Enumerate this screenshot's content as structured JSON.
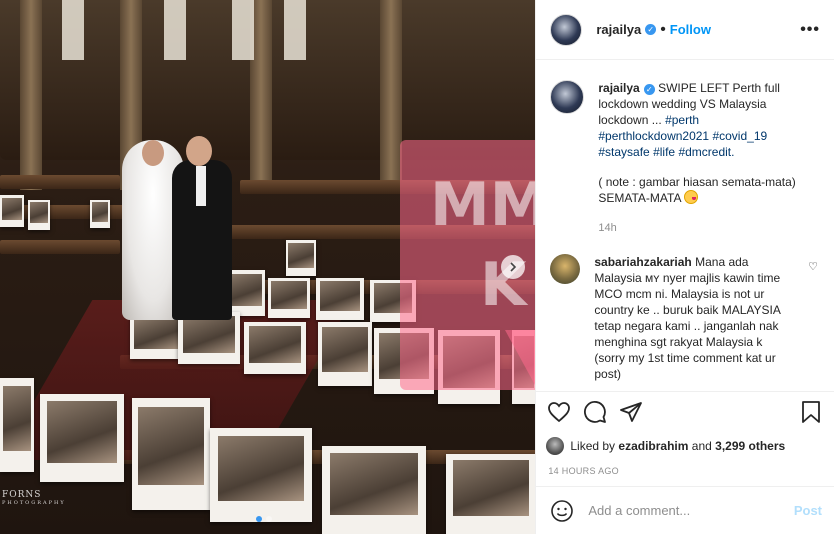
{
  "header": {
    "username": "rajailya",
    "separator": "•",
    "follow_label": "Follow",
    "more_label": "•••"
  },
  "caption": {
    "username": "rajailya",
    "text_prefix": "SWIPE LEFT Perth full lockdown wedding VS Malaysia lockdown ...",
    "hashtags": [
      "#perth",
      "#perthlockdown2021",
      "#covid_19",
      "#staysafe",
      "#life",
      "#dmcredit."
    ],
    "note": "( note : gambar hiasan semata-mata) SEMATA-MATA",
    "time": "14h"
  },
  "comment": {
    "username": "sabariahzakariah",
    "text": "Mana ada Malaysia ᴍʏ nyer majlis kawin time MCO mcm ni. Malaysia is not ur country ke .. buruk baik MALAYSIA tetap negara kami .. janganlah nak menghina sgt rakyat Malaysia k (sorry my 1st time comment kat ur post)"
  },
  "likes": {
    "prefix": "Liked by",
    "user": "ezadibrahim",
    "middle": "and",
    "count": "3,299 others"
  },
  "timestamp": "14 HOURS AGO",
  "add_comment": {
    "placeholder": "Add a comment...",
    "post_label": "Post"
  },
  "media": {
    "credit_main": "FORNS",
    "credit_sub": "PHOTOGRAPHY",
    "watermark_top": "MM",
    "watermark_bottom": "K",
    "slide_count": 2,
    "active_slide": 1
  },
  "colors": {
    "link": "#00376b",
    "follow": "#0095f6",
    "verified": "#3897f0",
    "muted": "#8e8e8e"
  }
}
